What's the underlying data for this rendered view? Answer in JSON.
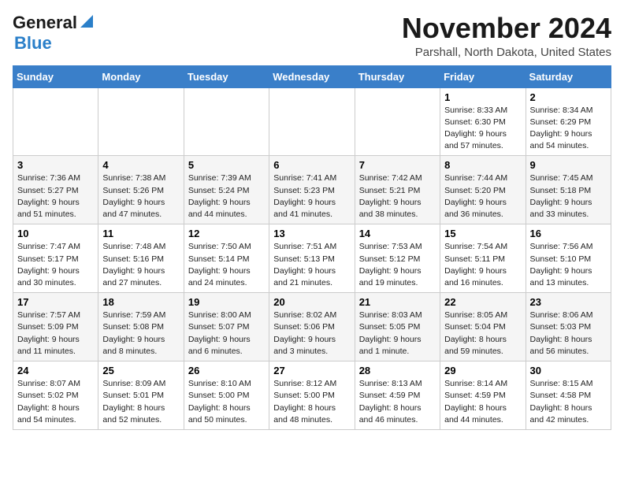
{
  "header": {
    "logo_line1": "General",
    "logo_line2": "Blue",
    "month": "November 2024",
    "location": "Parshall, North Dakota, United States"
  },
  "weekdays": [
    "Sunday",
    "Monday",
    "Tuesday",
    "Wednesday",
    "Thursday",
    "Friday",
    "Saturday"
  ],
  "weeks": [
    [
      {
        "day": "",
        "info": ""
      },
      {
        "day": "",
        "info": ""
      },
      {
        "day": "",
        "info": ""
      },
      {
        "day": "",
        "info": ""
      },
      {
        "day": "",
        "info": ""
      },
      {
        "day": "1",
        "info": "Sunrise: 8:33 AM\nSunset: 6:30 PM\nDaylight: 9 hours\nand 57 minutes."
      },
      {
        "day": "2",
        "info": "Sunrise: 8:34 AM\nSunset: 6:29 PM\nDaylight: 9 hours\nand 54 minutes."
      }
    ],
    [
      {
        "day": "3",
        "info": "Sunrise: 7:36 AM\nSunset: 5:27 PM\nDaylight: 9 hours\nand 51 minutes."
      },
      {
        "day": "4",
        "info": "Sunrise: 7:38 AM\nSunset: 5:26 PM\nDaylight: 9 hours\nand 47 minutes."
      },
      {
        "day": "5",
        "info": "Sunrise: 7:39 AM\nSunset: 5:24 PM\nDaylight: 9 hours\nand 44 minutes."
      },
      {
        "day": "6",
        "info": "Sunrise: 7:41 AM\nSunset: 5:23 PM\nDaylight: 9 hours\nand 41 minutes."
      },
      {
        "day": "7",
        "info": "Sunrise: 7:42 AM\nSunset: 5:21 PM\nDaylight: 9 hours\nand 38 minutes."
      },
      {
        "day": "8",
        "info": "Sunrise: 7:44 AM\nSunset: 5:20 PM\nDaylight: 9 hours\nand 36 minutes."
      },
      {
        "day": "9",
        "info": "Sunrise: 7:45 AM\nSunset: 5:18 PM\nDaylight: 9 hours\nand 33 minutes."
      }
    ],
    [
      {
        "day": "10",
        "info": "Sunrise: 7:47 AM\nSunset: 5:17 PM\nDaylight: 9 hours\nand 30 minutes."
      },
      {
        "day": "11",
        "info": "Sunrise: 7:48 AM\nSunset: 5:16 PM\nDaylight: 9 hours\nand 27 minutes."
      },
      {
        "day": "12",
        "info": "Sunrise: 7:50 AM\nSunset: 5:14 PM\nDaylight: 9 hours\nand 24 minutes."
      },
      {
        "day": "13",
        "info": "Sunrise: 7:51 AM\nSunset: 5:13 PM\nDaylight: 9 hours\nand 21 minutes."
      },
      {
        "day": "14",
        "info": "Sunrise: 7:53 AM\nSunset: 5:12 PM\nDaylight: 9 hours\nand 19 minutes."
      },
      {
        "day": "15",
        "info": "Sunrise: 7:54 AM\nSunset: 5:11 PM\nDaylight: 9 hours\nand 16 minutes."
      },
      {
        "day": "16",
        "info": "Sunrise: 7:56 AM\nSunset: 5:10 PM\nDaylight: 9 hours\nand 13 minutes."
      }
    ],
    [
      {
        "day": "17",
        "info": "Sunrise: 7:57 AM\nSunset: 5:09 PM\nDaylight: 9 hours\nand 11 minutes."
      },
      {
        "day": "18",
        "info": "Sunrise: 7:59 AM\nSunset: 5:08 PM\nDaylight: 9 hours\nand 8 minutes."
      },
      {
        "day": "19",
        "info": "Sunrise: 8:00 AM\nSunset: 5:07 PM\nDaylight: 9 hours\nand 6 minutes."
      },
      {
        "day": "20",
        "info": "Sunrise: 8:02 AM\nSunset: 5:06 PM\nDaylight: 9 hours\nand 3 minutes."
      },
      {
        "day": "21",
        "info": "Sunrise: 8:03 AM\nSunset: 5:05 PM\nDaylight: 9 hours\nand 1 minute."
      },
      {
        "day": "22",
        "info": "Sunrise: 8:05 AM\nSunset: 5:04 PM\nDaylight: 8 hours\nand 59 minutes."
      },
      {
        "day": "23",
        "info": "Sunrise: 8:06 AM\nSunset: 5:03 PM\nDaylight: 8 hours\nand 56 minutes."
      }
    ],
    [
      {
        "day": "24",
        "info": "Sunrise: 8:07 AM\nSunset: 5:02 PM\nDaylight: 8 hours\nand 54 minutes."
      },
      {
        "day": "25",
        "info": "Sunrise: 8:09 AM\nSunset: 5:01 PM\nDaylight: 8 hours\nand 52 minutes."
      },
      {
        "day": "26",
        "info": "Sunrise: 8:10 AM\nSunset: 5:00 PM\nDaylight: 8 hours\nand 50 minutes."
      },
      {
        "day": "27",
        "info": "Sunrise: 8:12 AM\nSunset: 5:00 PM\nDaylight: 8 hours\nand 48 minutes."
      },
      {
        "day": "28",
        "info": "Sunrise: 8:13 AM\nSunset: 4:59 PM\nDaylight: 8 hours\nand 46 minutes."
      },
      {
        "day": "29",
        "info": "Sunrise: 8:14 AM\nSunset: 4:59 PM\nDaylight: 8 hours\nand 44 minutes."
      },
      {
        "day": "30",
        "info": "Sunrise: 8:15 AM\nSunset: 4:58 PM\nDaylight: 8 hours\nand 42 minutes."
      }
    ]
  ]
}
